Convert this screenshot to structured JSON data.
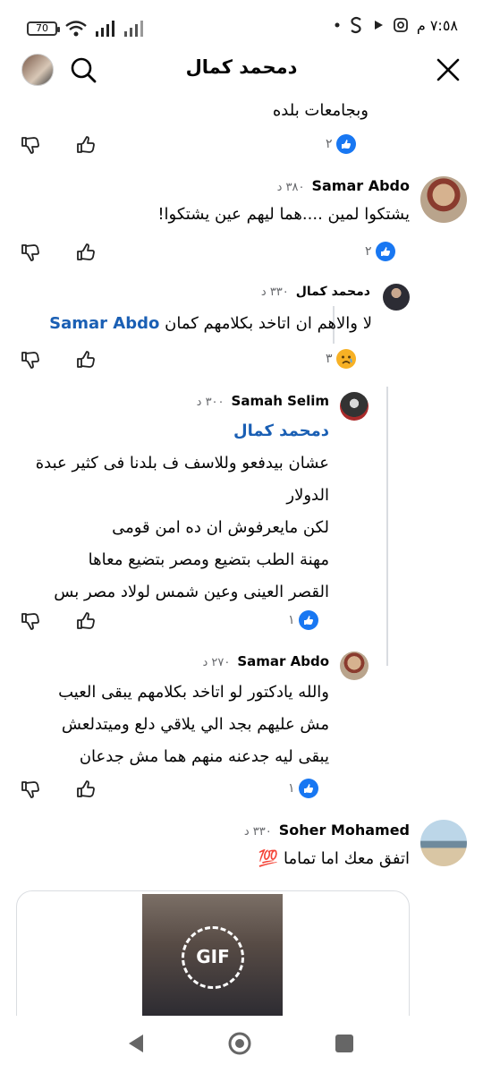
{
  "status_bar": {
    "battery": "70",
    "time": "٧:٥٨ م",
    "signal_icons": [
      "battery-icon",
      "wifi-icon",
      "signal-icon",
      "signal-icon-2"
    ],
    "app_icons": [
      "instagram-icon",
      "play-icon",
      "s-icon",
      "dot-icon"
    ]
  },
  "header": {
    "title": "دمحمد كمال"
  },
  "comments": [
    {
      "id": "c0",
      "text_lines": [
        "وبجامعات بلده"
      ],
      "likes": "٢"
    },
    {
      "id": "c1",
      "author": "Samar Abdo",
      "time": "٣٨٠ د",
      "text_lines": [
        "يشتكوا لمين ....هما ليهم عين يشتكوا!"
      ],
      "likes": "٢"
    },
    {
      "id": "c2",
      "author": "دمحمد كمال",
      "time": "٣٣٠ د",
      "mention": "Samar Abdo",
      "text_lines": [
        "لا والاهم ان اتاخد بكلامهم كمان"
      ],
      "likes": "٣"
    },
    {
      "id": "c3",
      "author": "Samah Selim",
      "time": "٣٠٠ د",
      "mention": "دمحمد كمال",
      "text_lines": [
        "عشان بيدفعو وللاسف ف بلدنا فى كثير عبدة",
        "الدولار",
        "لكن مايعرفوش ان ده امن قومى",
        "مهنة الطب بتضيع ومصر بتضيع معاها",
        "القصر العينى وعين شمس لولاد مصر بس"
      ],
      "likes": "١"
    },
    {
      "id": "c4",
      "author": "Samar Abdo",
      "time": "٢٧٠ د",
      "text_lines": [
        "والله يادكتور لو اتاخد بكلامهم يبقى العيب",
        "مش عليهم بجد الي يلاقي دلع وميتدلعش",
        "يبقى ليه جدعنه منهم هما مش جدعان"
      ],
      "likes": "١"
    },
    {
      "id": "c5",
      "author": "Soher Mohamed",
      "time": "٣٣٠ د",
      "text_lines": [
        "اتفق معك اما تماما 💯"
      ],
      "gif_label": "GIF"
    }
  ],
  "colors": {
    "like_blue": "#1877f2",
    "mention_blue": "#1a5fb4",
    "muted": "#65676b"
  },
  "nav": {
    "icons": [
      "back-icon",
      "home-icon",
      "recents-icon"
    ]
  }
}
